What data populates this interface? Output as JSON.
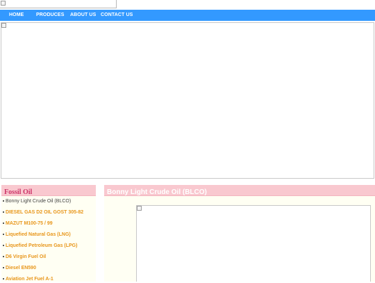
{
  "nav": {
    "items": [
      {
        "label": "HOME"
      },
      {
        "label": "PRODUCES"
      },
      {
        "label": "ABOUT US"
      },
      {
        "label": "CONTACT US"
      }
    ]
  },
  "sidebar": {
    "title": "Fossil Oil",
    "items": [
      {
        "label": "Bonny Light Crude Oil (BLCO)"
      },
      {
        "label": "DIESEL GAS D2 OIL GOST 305-82"
      },
      {
        "label": "MAZUT M100-75 / 99"
      },
      {
        "label": "Liquefied Natural Gas (LNG)"
      },
      {
        "label": "Liquefied Petroleum Gas (LPG)"
      },
      {
        "label": "D6 Virgin Fuel Oil"
      },
      {
        "label": "Diesel EN590"
      },
      {
        "label": "Aviation Jet Fuel A-1"
      }
    ]
  },
  "main": {
    "title": "Bonny Light Crude Oil (BLCO)"
  },
  "colors": {
    "nav_bg": "#3399ff",
    "header_bg": "#f9c8cf",
    "sidebar_title": "#cc3366",
    "link_highlight": "#e8961a",
    "panel_bg": "#fffff3"
  }
}
